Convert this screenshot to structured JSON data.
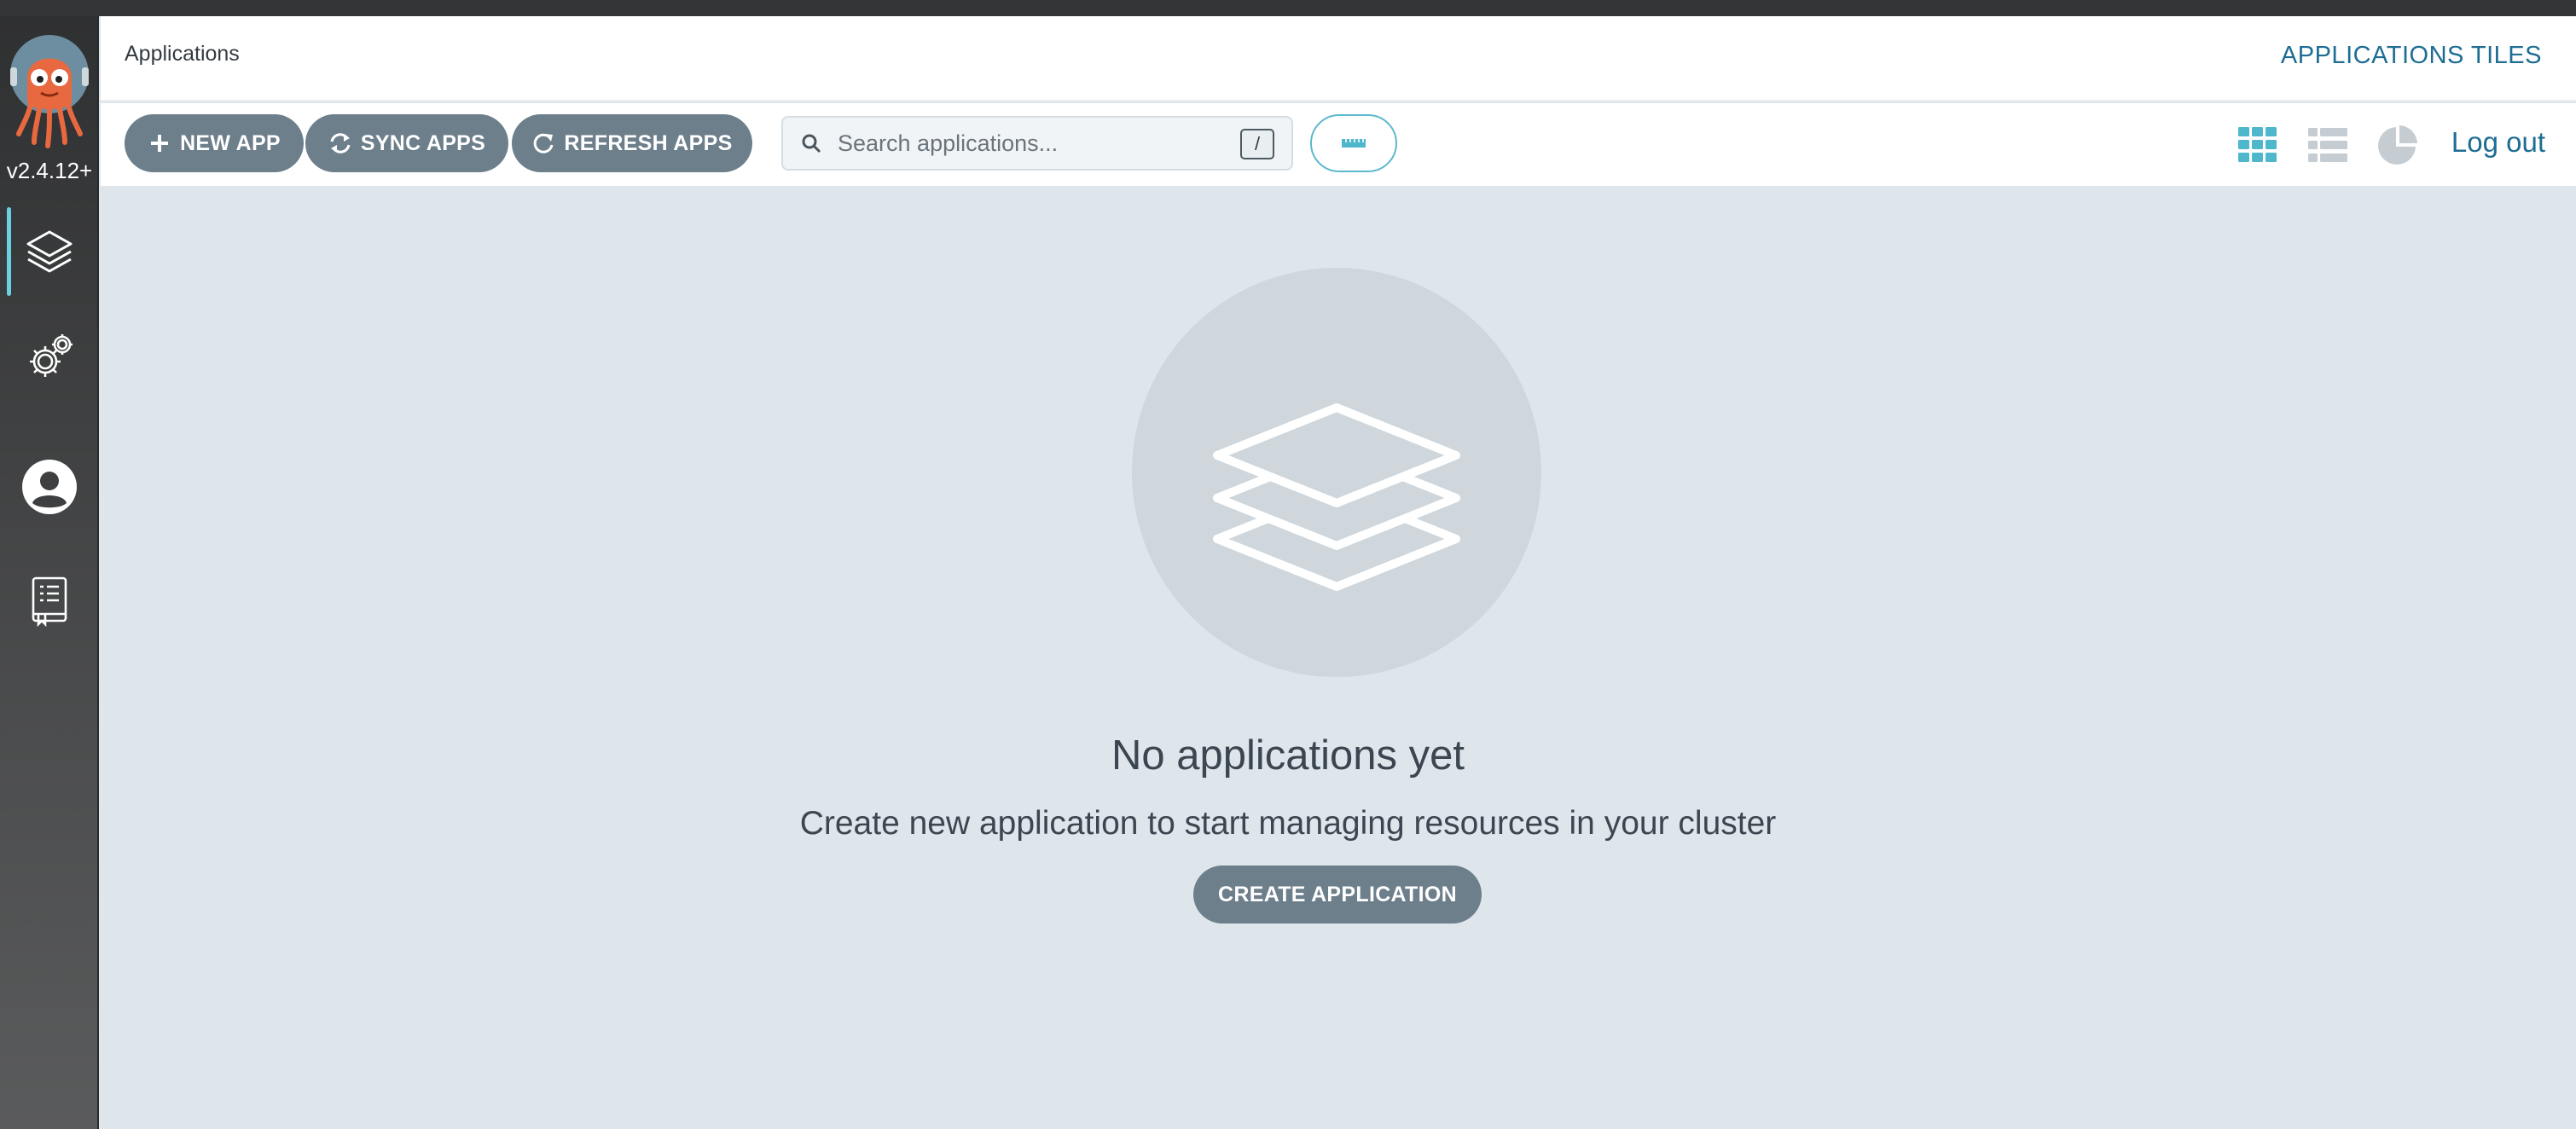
{
  "sidebar": {
    "version": "v2.4.12+",
    "logo": "argo-octopus-logo",
    "items": [
      {
        "name": "applications",
        "icon": "layers-icon",
        "active": true
      },
      {
        "name": "settings",
        "icon": "gears-icon",
        "active": false
      },
      {
        "name": "user-info",
        "icon": "user-circle-icon",
        "active": false
      },
      {
        "name": "documentation",
        "icon": "book-icon",
        "active": false
      }
    ]
  },
  "header": {
    "breadcrumb": "Applications",
    "title": "APPLICATIONS TILES"
  },
  "toolbar": {
    "new_app_label": "NEW APP",
    "sync_apps_label": "SYNC APPS",
    "refresh_apps_label": "REFRESH APPS",
    "search_placeholder": "Search applications...",
    "search_shortcut": "/",
    "filter_icon": "ruler-icon",
    "views": [
      "tiles-view-icon",
      "list-view-icon",
      "summary-pie-icon"
    ],
    "logout_label": "Log out"
  },
  "main": {
    "empty_title": "No applications yet",
    "empty_subtitle": "Create new application to start managing resources in your cluster",
    "create_label": "CREATE APPLICATION"
  },
  "colors": {
    "accent": "#1e6d94",
    "active_indicator": "#6bd1e2",
    "button_bg": "#6d7f8b",
    "tiles_active": "#4fb7cc",
    "background": "#dee6eb"
  }
}
